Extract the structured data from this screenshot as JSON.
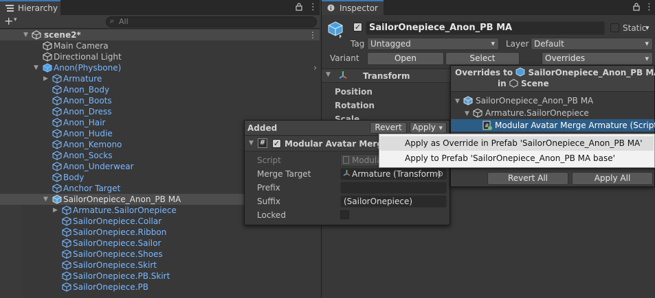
{
  "hierarchy": {
    "tab_label": "Hierarchy",
    "search_placeholder": "All",
    "scene_name": "scene2*",
    "items": [
      {
        "label": "Main Camera",
        "indent": 1,
        "blue": false,
        "arrow": ""
      },
      {
        "label": "Directional Light",
        "indent": 1,
        "blue": false,
        "arrow": ""
      },
      {
        "label": "Anon(Physbone)",
        "indent": 1,
        "blue": true,
        "arrow": "▼"
      },
      {
        "label": "Armature",
        "indent": 2,
        "blue": true,
        "arrow": "▶"
      },
      {
        "label": "Anon_Body",
        "indent": 2,
        "blue": true,
        "arrow": ""
      },
      {
        "label": "Anon_Boots",
        "indent": 2,
        "blue": true,
        "arrow": ""
      },
      {
        "label": "Anon_Dress",
        "indent": 2,
        "blue": true,
        "arrow": ""
      },
      {
        "label": "Anon_Hair",
        "indent": 2,
        "blue": true,
        "arrow": ""
      },
      {
        "label": "Anon_Hudie",
        "indent": 2,
        "blue": true,
        "arrow": ""
      },
      {
        "label": "Anon_Kemono",
        "indent": 2,
        "blue": true,
        "arrow": ""
      },
      {
        "label": "Anon_Socks",
        "indent": 2,
        "blue": true,
        "arrow": ""
      },
      {
        "label": "Anon_Underwear",
        "indent": 2,
        "blue": true,
        "arrow": ""
      },
      {
        "label": "Body",
        "indent": 2,
        "blue": true,
        "arrow": ""
      },
      {
        "label": "Anchor Target",
        "indent": 2,
        "blue": true,
        "arrow": ""
      },
      {
        "label": "SailorOnepiece_Anon_PB MA",
        "indent": 2,
        "blue": false,
        "arrow": "▼",
        "selected": true
      },
      {
        "label": "Armature.SailorOnepiece",
        "indent": 3,
        "blue": true,
        "arrow": "▶"
      },
      {
        "label": "SailorOnepiece.Collar",
        "indent": 3,
        "blue": true,
        "arrow": ""
      },
      {
        "label": "SailorOnepiece.Ribbon",
        "indent": 3,
        "blue": true,
        "arrow": ""
      },
      {
        "label": "SailorOnepiece.Sailor",
        "indent": 3,
        "blue": true,
        "arrow": ""
      },
      {
        "label": "SailorOnepiece.Shoes",
        "indent": 3,
        "blue": true,
        "arrow": ""
      },
      {
        "label": "SailorOnepiece.Skirt",
        "indent": 3,
        "blue": true,
        "arrow": ""
      },
      {
        "label": "SailorOnepiece.PB.Skirt",
        "indent": 3,
        "blue": true,
        "arrow": ""
      },
      {
        "label": "SailorOnepiece.PB",
        "indent": 3,
        "blue": true,
        "arrow": ""
      }
    ]
  },
  "inspector": {
    "tab_label": "Inspector",
    "object_name": "SailorOnepiece_Anon_PB MA",
    "static_label": "Static",
    "tag_label": "Tag",
    "tag_value": "Untagged",
    "layer_label": "Layer",
    "layer_value": "Default",
    "variant_label": "Variant",
    "open_label": "Open",
    "select_label": "Select",
    "overrides_label": "Overrides",
    "transform_label": "Transform",
    "position_label": "Position",
    "rotation_label": "Rotation",
    "scale_label": "Scale"
  },
  "added_popup": {
    "title": "Added",
    "revert_label": "Revert",
    "apply_label": "Apply",
    "component_name": "Modular Avatar Merge",
    "script_label": "Script",
    "script_value": "Modula",
    "merge_target_label": "Merge Target",
    "merge_target_value": "Armature (Transform)",
    "prefix_label": "Prefix",
    "prefix_value": "",
    "suffix_label": "Suffix",
    "suffix_value": "(SailorOnepiece)",
    "locked_label": "Locked"
  },
  "overrides_popup": {
    "title_prefix": "Overrides to",
    "title_object": "SailorOnepiece_Anon_PB MA",
    "title_in": "in",
    "title_scene": "Scene",
    "tree": [
      {
        "label": "SailorOnepiece_Anon_PB MA",
        "indent": 0
      },
      {
        "label": "Armature.SailorOnepiece",
        "indent": 1
      },
      {
        "label": "Modular Avatar Merge Armature (Script)",
        "indent": 2,
        "selected": true
      }
    ],
    "revert_all_label": "Revert All",
    "apply_all_label": "Apply All"
  },
  "context_menu": {
    "items": [
      "Apply as Override in Prefab 'SailorOnepiece_Anon_PB MA'",
      "Apply to Prefab 'SailorOnepiece_Anon_PB MA base'"
    ]
  },
  "colors": {
    "accent": "#3a79bb",
    "selection": "#2c5d87",
    "prefab_blue": "#7ab8ff"
  }
}
